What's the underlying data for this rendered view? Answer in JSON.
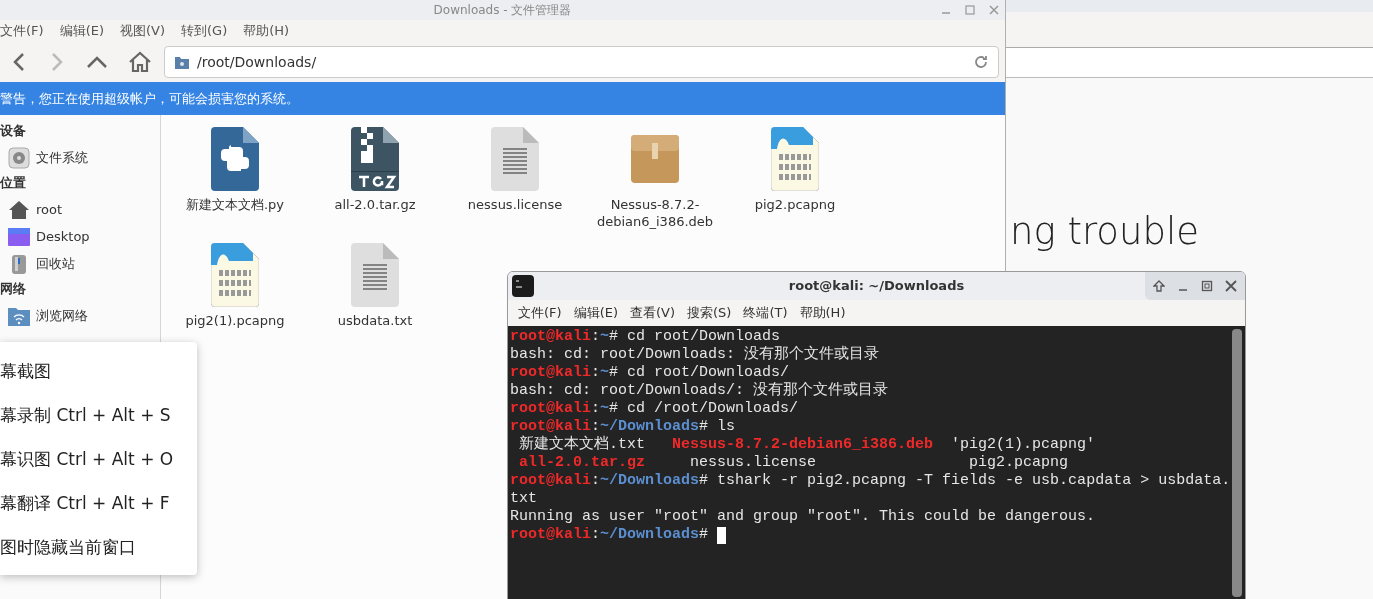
{
  "file_manager": {
    "title": "Downloads - 文件管理器",
    "menu": [
      "文件(F)",
      "编辑(E)",
      "视图(V)",
      "转到(G)",
      "帮助(H)"
    ],
    "address": "/root/Downloads/",
    "warning": "警告，您正在使用超级帐户，可能会损害您的系统。",
    "sidebar": [
      {
        "heading": "设备",
        "items": [
          {
            "label": "文件系统",
            "kind": "drive"
          }
        ]
      },
      {
        "heading": "位置",
        "items": [
          {
            "label": "root",
            "kind": "home"
          },
          {
            "label": "Desktop",
            "kind": "desktop"
          },
          {
            "label": "回收站",
            "kind": "trash"
          }
        ]
      },
      {
        "heading": "网络",
        "items": [
          {
            "label": "浏览网络",
            "kind": "network"
          }
        ]
      }
    ],
    "files": [
      {
        "name": "新建文本文档.py",
        "kind": "python"
      },
      {
        "name": "all-2.0.tar.gz",
        "kind": "tgz"
      },
      {
        "name": "nessus.license",
        "kind": "text"
      },
      {
        "name": "Nessus-8.7.2-debian6_i386.deb",
        "kind": "package"
      },
      {
        "name": "pig2.pcapng",
        "kind": "pcap"
      },
      {
        "name": "pig2(1).pcapng",
        "kind": "pcap"
      },
      {
        "name": "usbdata.txt",
        "kind": "text"
      }
    ]
  },
  "context_menu": {
    "items": [
      "幕截图",
      "幕录制 Ctrl + Alt + S",
      "幕识图 Ctrl + Alt + O",
      "幕翻译 Ctrl + Alt + F",
      "图时隐藏当前窗口"
    ]
  },
  "browser": {
    "heading": "ng trouble"
  },
  "terminal": {
    "title": "root@kali: ~/Downloads",
    "menu": [
      "文件(F)",
      "编辑(E)",
      "查看(V)",
      "搜索(S)",
      "终端(T)",
      "帮助(H)"
    ],
    "lines": [
      [
        {
          "text": "root@kali",
          "kind": "user"
        },
        {
          "text": ":",
          "kind": "plain"
        },
        {
          "text": "~",
          "kind": "path"
        },
        {
          "text": "# cd root/Downloads",
          "kind": "plain"
        }
      ],
      [
        {
          "text": "bash: cd: root/Downloads: 没有那个文件或目录",
          "kind": "plain"
        }
      ],
      [
        {
          "text": "root@kali",
          "kind": "user"
        },
        {
          "text": ":",
          "kind": "plain"
        },
        {
          "text": "~",
          "kind": "path"
        },
        {
          "text": "# cd root/Downloads/",
          "kind": "plain"
        }
      ],
      [
        {
          "text": "bash: cd: root/Downloads/: 没有那个文件或目录",
          "kind": "plain"
        }
      ],
      [
        {
          "text": "root@kali",
          "kind": "user"
        },
        {
          "text": ":",
          "kind": "plain"
        },
        {
          "text": "~",
          "kind": "path"
        },
        {
          "text": "# cd /root/Downloads/",
          "kind": "plain"
        }
      ],
      [
        {
          "text": "root@kali",
          "kind": "user"
        },
        {
          "text": ":",
          "kind": "plain"
        },
        {
          "text": "~/Downloads",
          "kind": "path"
        },
        {
          "text": "# ls",
          "kind": "plain"
        }
      ],
      [
        {
          "text": " 新建文本文档.txt   ",
          "kind": "plain"
        },
        {
          "text": "Nessus-8.7.2-debian6_i386.deb",
          "kind": "archive"
        },
        {
          "text": "  'pig2(1).pcapng'",
          "kind": "plain"
        }
      ],
      [
        {
          "text": " all-2.0.tar.gz",
          "kind": "archive"
        },
        {
          "text": "     nessus.license                 pig2.pcapng",
          "kind": "plain"
        }
      ],
      [
        {
          "text": "root@kali",
          "kind": "user"
        },
        {
          "text": ":",
          "kind": "plain"
        },
        {
          "text": "~/Downloads",
          "kind": "path"
        },
        {
          "text": "# tshark -r pig2.pcapng -T fields -e usb.capdata > usbdata.",
          "kind": "plain"
        }
      ],
      [
        {
          "text": "txt",
          "kind": "plain"
        }
      ],
      [
        {
          "text": "Running as user \"root\" and group \"root\". This could be dangerous.",
          "kind": "plain"
        }
      ],
      [
        {
          "text": "root@kali",
          "kind": "user"
        },
        {
          "text": ":",
          "kind": "plain"
        },
        {
          "text": "~/Downloads",
          "kind": "path"
        },
        {
          "text": "# ",
          "kind": "plain"
        }
      ]
    ],
    "cursor": true
  }
}
